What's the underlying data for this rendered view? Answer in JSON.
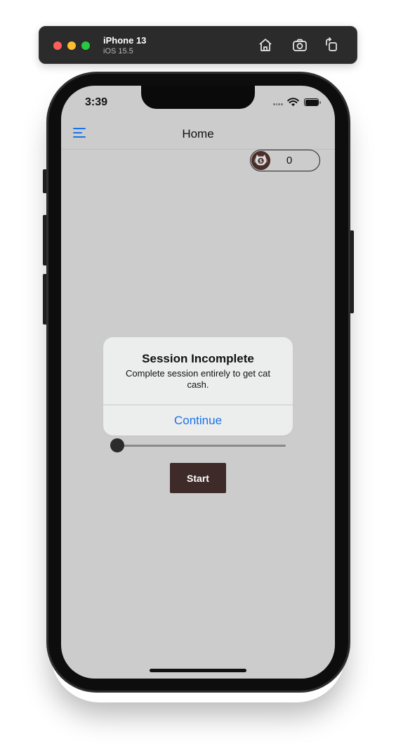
{
  "simulator": {
    "device_name": "iPhone 13",
    "os_version": "iOS 15.5",
    "icons": [
      "home-icon",
      "screenshot-icon",
      "rotate-icon"
    ]
  },
  "status_bar": {
    "time": "3:39",
    "icons": [
      "wifi-icon",
      "battery-icon"
    ]
  },
  "header": {
    "title": "Home",
    "menu_icon": "hamburger-menu-icon"
  },
  "wallet": {
    "icon": "cat-cash-icon",
    "count": "0"
  },
  "alert": {
    "title": "Session Incomplete",
    "message": "Complete session entirely to get cat cash.",
    "action_label": "Continue"
  },
  "session_slider": {
    "value": 0
  },
  "start_button": {
    "label": "Start"
  },
  "colors": {
    "accent": "#1a73e8",
    "button_background": "#3e2a28",
    "screen_background": "#cccccc",
    "alert_background": "#eceded"
  }
}
